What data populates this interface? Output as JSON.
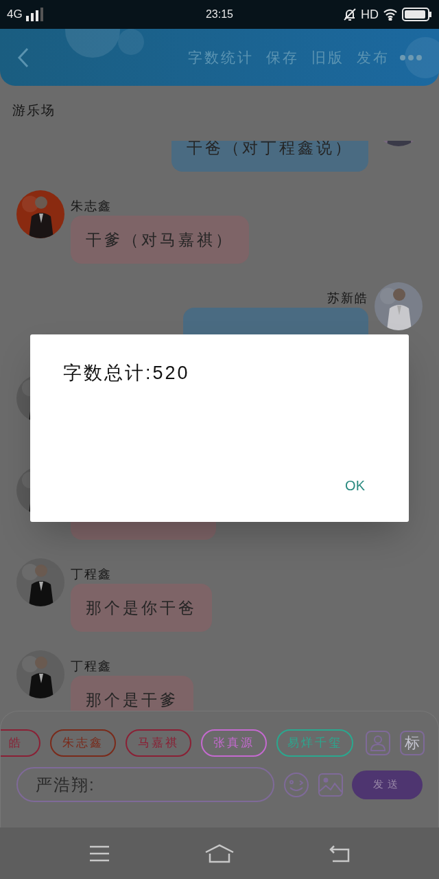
{
  "status_bar": {
    "network": "4G",
    "time": "23:15",
    "hd": "HD"
  },
  "header": {
    "actions": [
      "字数统计",
      "保存",
      "旧版",
      "发布"
    ]
  },
  "room_title": "游乐场",
  "messages": [
    {
      "kind": "outgoing",
      "color": "#4a6b82",
      "text": "干爸（对丁程鑫说）"
    },
    {
      "kind": "incoming",
      "color": "#7e6467",
      "name": "朱志鑫",
      "text": "干爹（对马嘉祺）"
    },
    {
      "kind": "outgoing",
      "color": "#4a6b82",
      "name": "苏新皓"
    },
    {
      "kind": "incoming"
    },
    {
      "kind": "incoming",
      "color": "#7e6467"
    },
    {
      "kind": "incoming",
      "color": "#7e6467",
      "name": "丁程鑫",
      "text": "那个是你干爸"
    },
    {
      "kind": "incoming",
      "color": "#7e6467",
      "name": "丁程鑫",
      "text": "那个是干爹"
    }
  ],
  "roles": [
    {
      "label": "皓",
      "color": "#8a2035"
    },
    {
      "label": "朱志鑫",
      "color": "#7a2a1a"
    },
    {
      "label": "马嘉祺",
      "color": "#8a2035"
    },
    {
      "label": "张真源",
      "color": "#c56ad0"
    },
    {
      "label": "易烊千玺",
      "color": "#2aa88f"
    }
  ],
  "tag_button": "标",
  "input": {
    "value": "严浩翔:"
  },
  "send_button": "发送",
  "dialog": {
    "message": "字数总计:520",
    "button": "OK"
  }
}
